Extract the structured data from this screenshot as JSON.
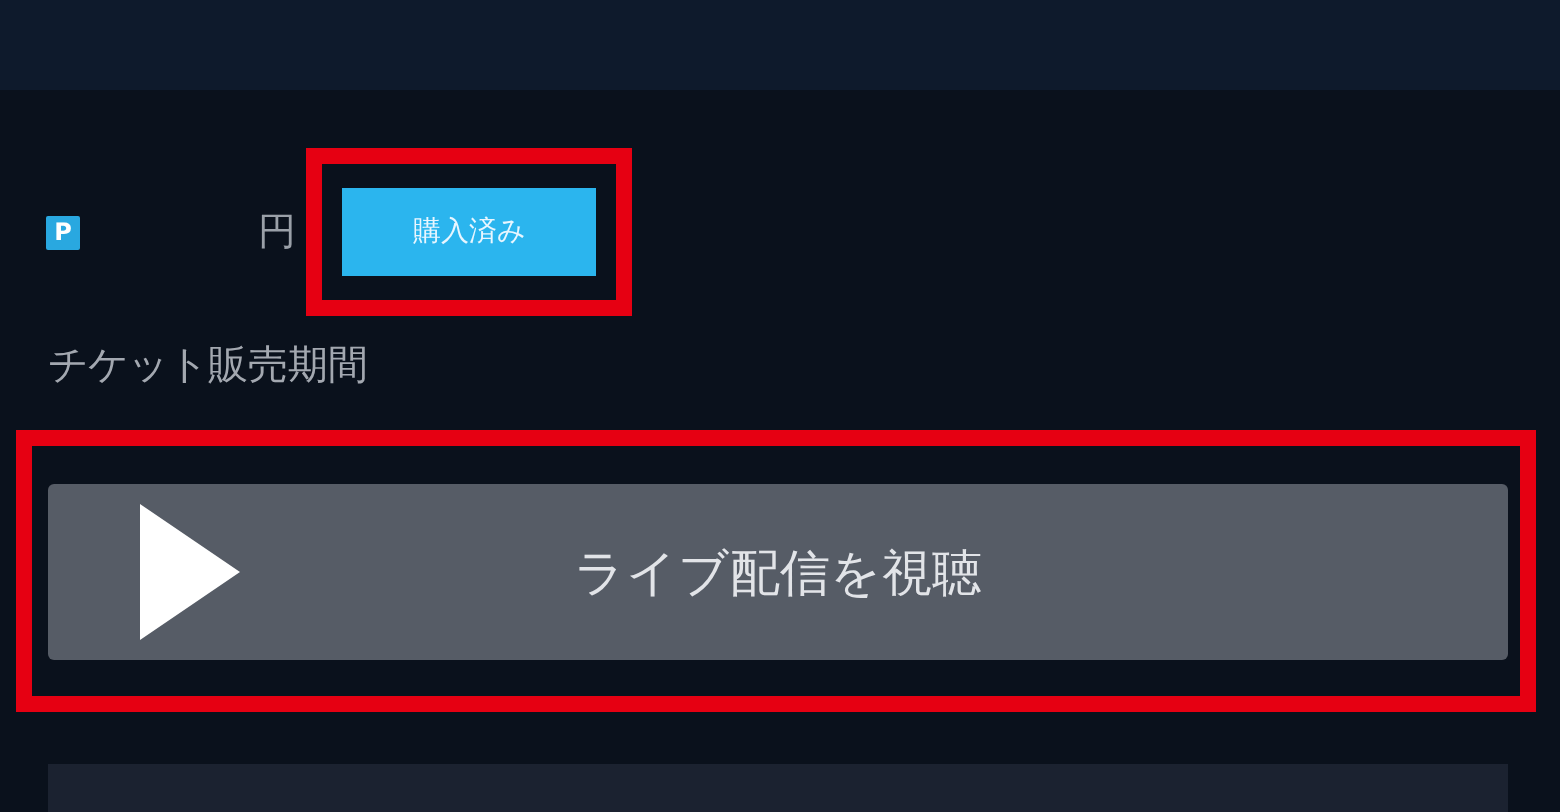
{
  "price": {
    "point_mark": "P",
    "currency": "円"
  },
  "status_badge": "購入済み",
  "sale_period_label": "チケット販売期間",
  "watch_button": {
    "label": "ライブ配信を視聴"
  }
}
